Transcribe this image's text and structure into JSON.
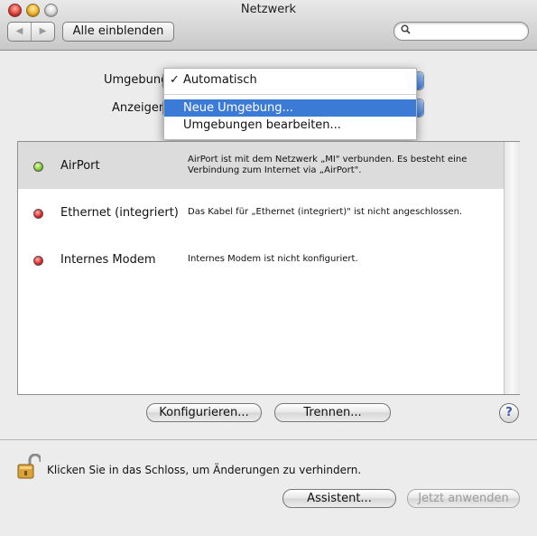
{
  "window": {
    "title": "Netzwerk"
  },
  "toolbar": {
    "back_glyph": "◀",
    "forward_glyph": "▶",
    "show_all_label": "Alle einblenden",
    "search_placeholder": ""
  },
  "environment": {
    "location_label": "Umgebung",
    "show_label": "Anzeigen",
    "menu": {
      "checkmark": "✓",
      "items": [
        {
          "label": "Automatisch",
          "checked": true,
          "highlighted": false
        },
        {
          "label": "Neue Umgebung...",
          "checked": false,
          "highlighted": true
        },
        {
          "label": "Umgebungen bearbeiten...",
          "checked": false,
          "highlighted": false
        }
      ]
    }
  },
  "services": [
    {
      "name": "AirPort",
      "status_color": "green",
      "selected": true,
      "description": "AirPort ist mit dem Netzwerk „MI\" verbunden. Es besteht eine Verbindung zum Internet via „AirPort\"."
    },
    {
      "name": "Ethernet (integriert)",
      "status_color": "red",
      "selected": false,
      "description": "Das Kabel für „Ethernet (integriert)\" ist nicht angeschlossen."
    },
    {
      "name": "Internes Modem",
      "status_color": "red",
      "selected": false,
      "description": "Internes Modem ist nicht konfiguriert."
    }
  ],
  "buttons": {
    "configure": "Konfigurieren...",
    "disconnect": "Trennen...",
    "help": "?",
    "assistant": "Assistent...",
    "apply": "Jetzt anwenden"
  },
  "lock": {
    "text": "Klicken Sie in das Schloss, um Änderungen zu verhindern."
  }
}
